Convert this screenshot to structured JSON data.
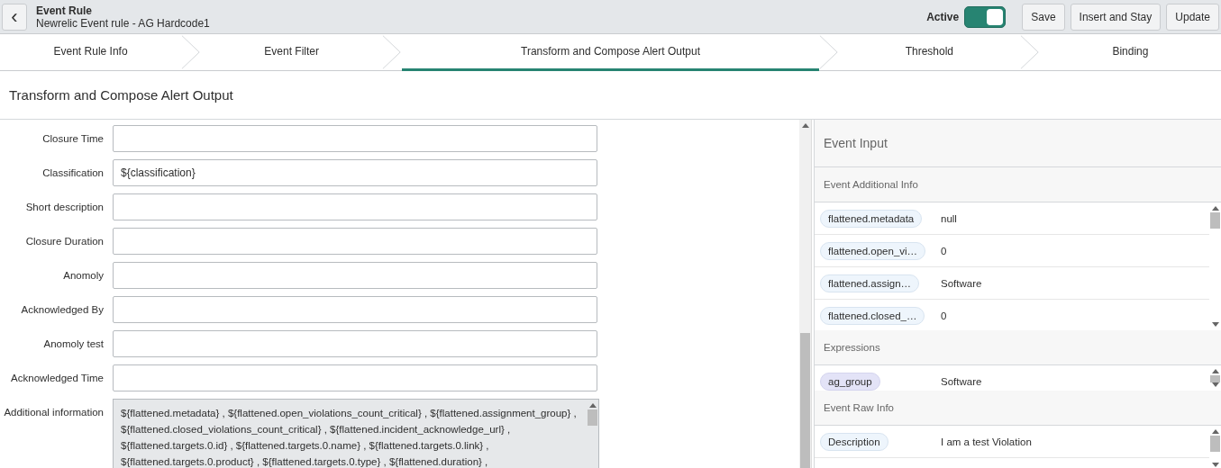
{
  "header": {
    "back_label": "‹",
    "title": "Event Rule",
    "subtitle": "Newrelic Event rule - AG Hardcode1",
    "active_label": "Active",
    "active_on": true,
    "buttons": [
      "Save",
      "Insert and Stay",
      "Update"
    ]
  },
  "steps": [
    {
      "label": "Event Rule Info",
      "selected": false
    },
    {
      "label": "Event Filter",
      "selected": false
    },
    {
      "label": "Transform and Compose Alert Output",
      "selected": true
    },
    {
      "label": "Threshold",
      "selected": false
    },
    {
      "label": "Binding",
      "selected": false
    }
  ],
  "section_title": "Transform and Compose Alert Output",
  "form": [
    {
      "label": "Closure Time",
      "kind": "input"
    },
    {
      "label": "Classification",
      "kind": "input",
      "value": "${classification}"
    },
    {
      "label": "Short description",
      "kind": "input"
    },
    {
      "label": "Closure Duration",
      "kind": "input"
    },
    {
      "label": "Anomoly",
      "kind": "input"
    },
    {
      "label": "Acknowledged By",
      "kind": "input"
    },
    {
      "label": "Anomoly test",
      "kind": "input"
    },
    {
      "label": "Acknowledged Time",
      "kind": "input"
    },
    {
      "label": "Additional information",
      "kind": "textarea",
      "value_lines": [
        "${flattened.metadata} , ${flattened.open_violations_count_critical} , ${flattened.assignment_group} ,",
        "${flattened.closed_violations_count_critical} , ${flattened.incident_acknowledge_url} ,",
        "${flattened.targets.0.id} , ${flattened.targets.0.name} , ${flattened.targets.0.link} ,",
        "${flattened.targets.0.product} , ${flattened.targets.0.type} , ${flattened.duration} ,"
      ]
    }
  ],
  "event_input": {
    "title": "Event Input",
    "sections": [
      {
        "title": "Event Additional Info",
        "kind": "variable",
        "rows": [
          {
            "key": "flattened.metadata",
            "value": "null"
          },
          {
            "key": "flattened.open_vi…",
            "value": "0"
          },
          {
            "key": "flattened.assign…",
            "value": "Software"
          },
          {
            "key": "flattened.closed_…",
            "value": "0"
          }
        ]
      },
      {
        "title": "Expressions",
        "kind": "expression",
        "rows": [
          {
            "key": "ag_group",
            "value": "Software"
          }
        ]
      },
      {
        "title": "Event Raw Info",
        "kind": "variable",
        "rows": [
          {
            "key": "Description",
            "value": "I am a test Violation"
          }
        ]
      }
    ]
  }
}
